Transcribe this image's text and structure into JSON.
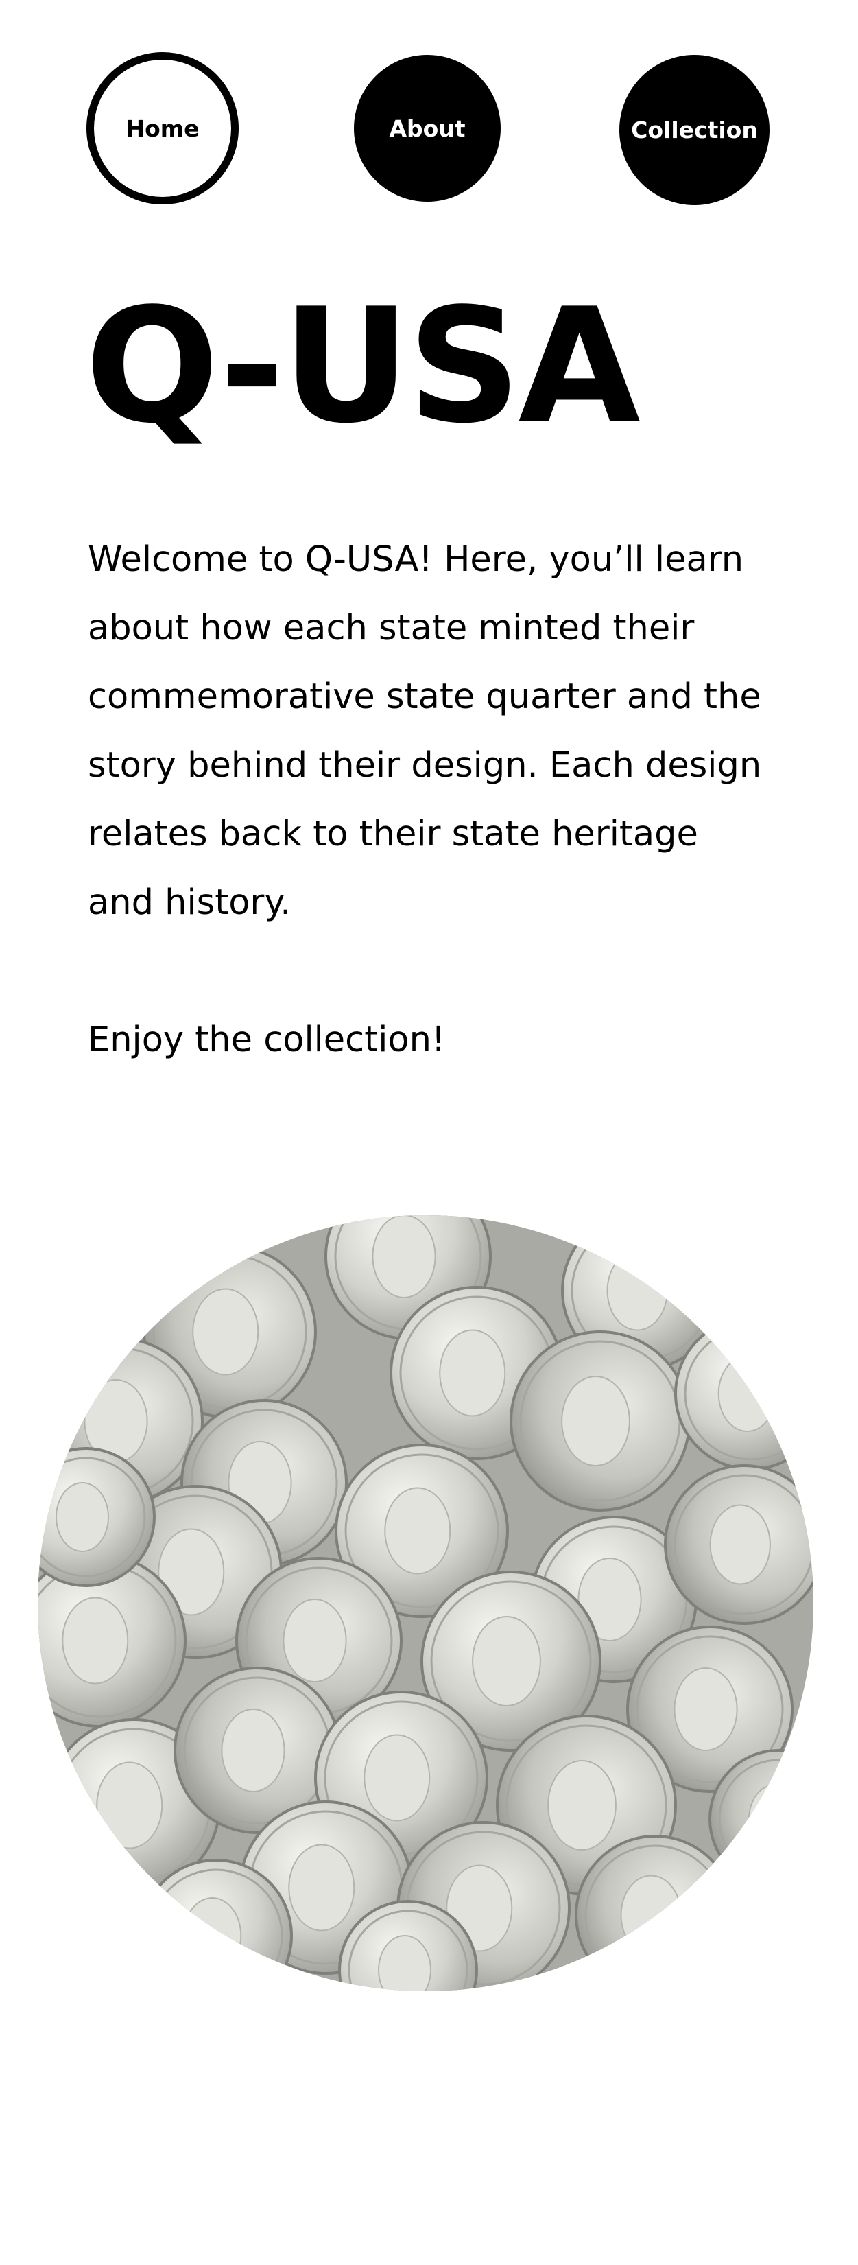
{
  "nav": {
    "items": [
      {
        "label": "Home"
      },
      {
        "label": "About"
      },
      {
        "label": "Collection"
      }
    ]
  },
  "hero": {
    "title": "Q-USA",
    "intro": "Welcome to Q-USA! Here, you’ll learn about how each state minted their commemorative state quarter and the story behind their design. Each design relates back to their state heritage and history.",
    "closing": "Enjoy the collection!"
  },
  "colors": {
    "background": "#ffffff",
    "text": "#000000",
    "nav_active_bg": "#ffffff",
    "nav_inactive_bg": "#000000"
  }
}
